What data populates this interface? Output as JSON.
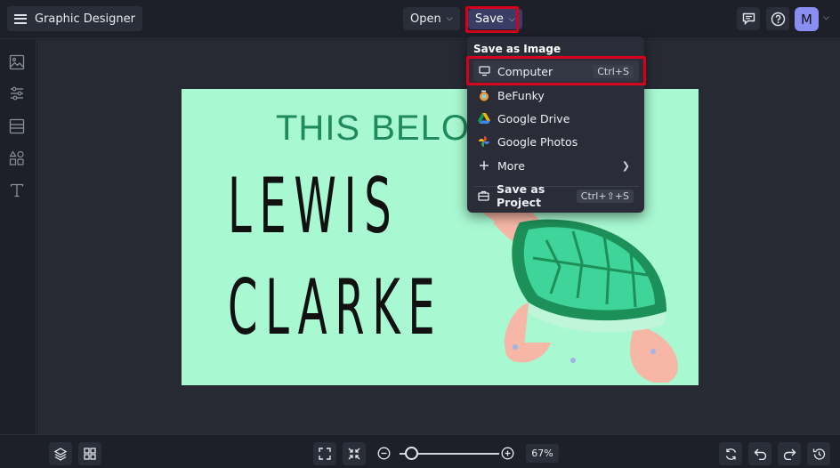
{
  "app": {
    "title": "Graphic Designer"
  },
  "toolbar": {
    "open_label": "Open",
    "save_label": "Save",
    "avatar_initial": "M"
  },
  "save_menu": {
    "header": "Save as Image",
    "items": [
      {
        "label": "Computer",
        "shortcut": "Ctrl+S",
        "icon": "monitor-icon"
      },
      {
        "label": "BeFunky",
        "icon": "befunky-icon"
      },
      {
        "label": "Google Drive",
        "icon": "google-drive-icon"
      },
      {
        "label": "Google Photos",
        "icon": "google-photos-icon"
      },
      {
        "label": "More",
        "icon": "plus-icon"
      }
    ],
    "project": {
      "label": "Save as Project",
      "shortcut": "Ctrl+⇧+S",
      "icon": "briefcase-icon"
    }
  },
  "canvas": {
    "headline": "THIS BELO",
    "name_line1": "LEWIS",
    "name_line2": "CLARKE",
    "background": "#a8f8d2"
  },
  "zoom": {
    "value": "67%",
    "level": 0.1
  },
  "colors": {
    "accent": "#3a3d66",
    "highlight": "#d6001c",
    "app_bg": "#1d2029"
  }
}
